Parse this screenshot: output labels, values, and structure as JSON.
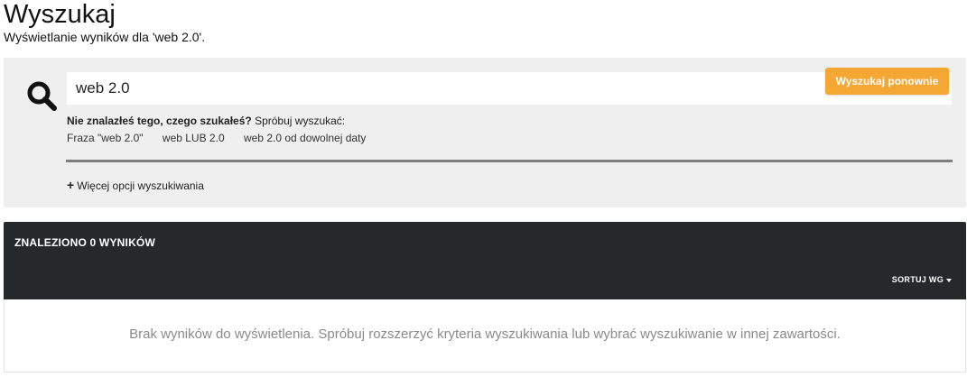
{
  "header": {
    "title": "Wyszukaj",
    "subtitle": "Wyświetlanie wyników dla 'web 2.0'."
  },
  "search": {
    "query": "web 2.0",
    "button_label": "Wyszukaj ponownie",
    "suggest_bold": "Nie znalazłeś tego, czego szukałeś?",
    "suggest_text": " Spróbuj wyszukać:",
    "suggestions": [
      "Fraza \"web 2.0\"",
      "web LUB 2.0",
      "web 2.0 od dowolnej daty"
    ],
    "more_options": "Więcej opcji wyszukiwania",
    "colors": {
      "button": "#f5a733",
      "panel": "#efeff0"
    }
  },
  "results": {
    "count_label": "ZNALEZIONO 0 WYNIKÓW",
    "sort_label": "SORTUJ WG",
    "empty_message": "Brak wyników do wyświetlenia. Spróbuj rozszerzyć kryteria wyszukiwania lub wybrać wyszukiwanie w innej zawartości.",
    "colors": {
      "header_bg": "#25292c"
    }
  }
}
